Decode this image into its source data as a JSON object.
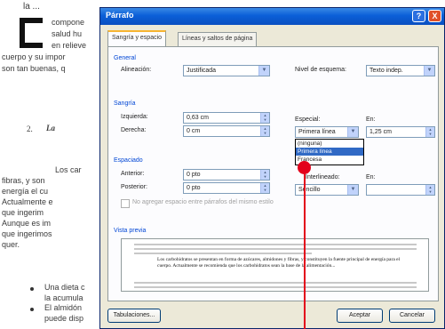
{
  "document": {
    "top_fragment": "la ...",
    "lines_top": [
      "compone",
      "salud hu",
      "en relieve"
    ],
    "line_cuerpo": "cuerpo y su impor",
    "line_buenas": "son tan buenas, q",
    "heading_number": "2.",
    "heading_word": "La",
    "para_lines": [
      "Los car",
      "fibras, y son",
      "energía el cu",
      "Actualmente e",
      "que ingerim",
      "Aunque es im",
      "que ingerimos",
      "quer."
    ],
    "bullet_lines": [
      "Una dieta c",
      "la acumula",
      "El almidón",
      "puede disp"
    ]
  },
  "dialog": {
    "title": "Párrafo",
    "help_glyph": "?",
    "close_glyph": "X",
    "tabs": [
      "Sangría y espacio",
      "Líneas y saltos de página"
    ],
    "general": {
      "group_label": "General",
      "alignment_label": "Alineación:",
      "alignment_value": "Justificada",
      "outline_label": "Nivel de esquema:",
      "outline_value": "Texto indep."
    },
    "indent": {
      "group_label": "Sangría",
      "left_label": "Izquierda:",
      "left_value": "0,63 cm",
      "right_label": "Derecha:",
      "right_value": "0 cm",
      "special_label": "Especial:",
      "special_value": "Primera línea",
      "by_label": "En:",
      "by_value": "1,25 cm"
    },
    "special_dropdown": {
      "options": [
        "(ninguna)",
        "Primera línea",
        "Francesa"
      ],
      "selected_index": 1
    },
    "spacing": {
      "group_label": "Espaciado",
      "before_label": "Anterior:",
      "before_value": "0 pto",
      "after_label": "Posterior:",
      "after_value": "0 pto",
      "line_label": "Interlineado:",
      "line_value": "Sencillo",
      "at_label": "En:",
      "at_value": "",
      "checkbox_label": "No agregar espacio entre párrafos del mismo estilo"
    },
    "preview": {
      "group_label": "Vista previa",
      "text": "Los carbohidratos se presentan en forma de azúcares, almidones y fibras, y constituyen la fuente principal de energía para el cuerpo. Actualmente se recomienda que los carbohidratos sean la base de la alimentación..."
    },
    "buttons": {
      "tabs_button": "Tabulaciones...",
      "accept": "Aceptar",
      "cancel": "Cancelar"
    }
  },
  "colors": {
    "titlebar": "#0b5fd8",
    "group_label": "#0046d5",
    "selection": "#316ac5",
    "pointer": "#e3001b"
  }
}
